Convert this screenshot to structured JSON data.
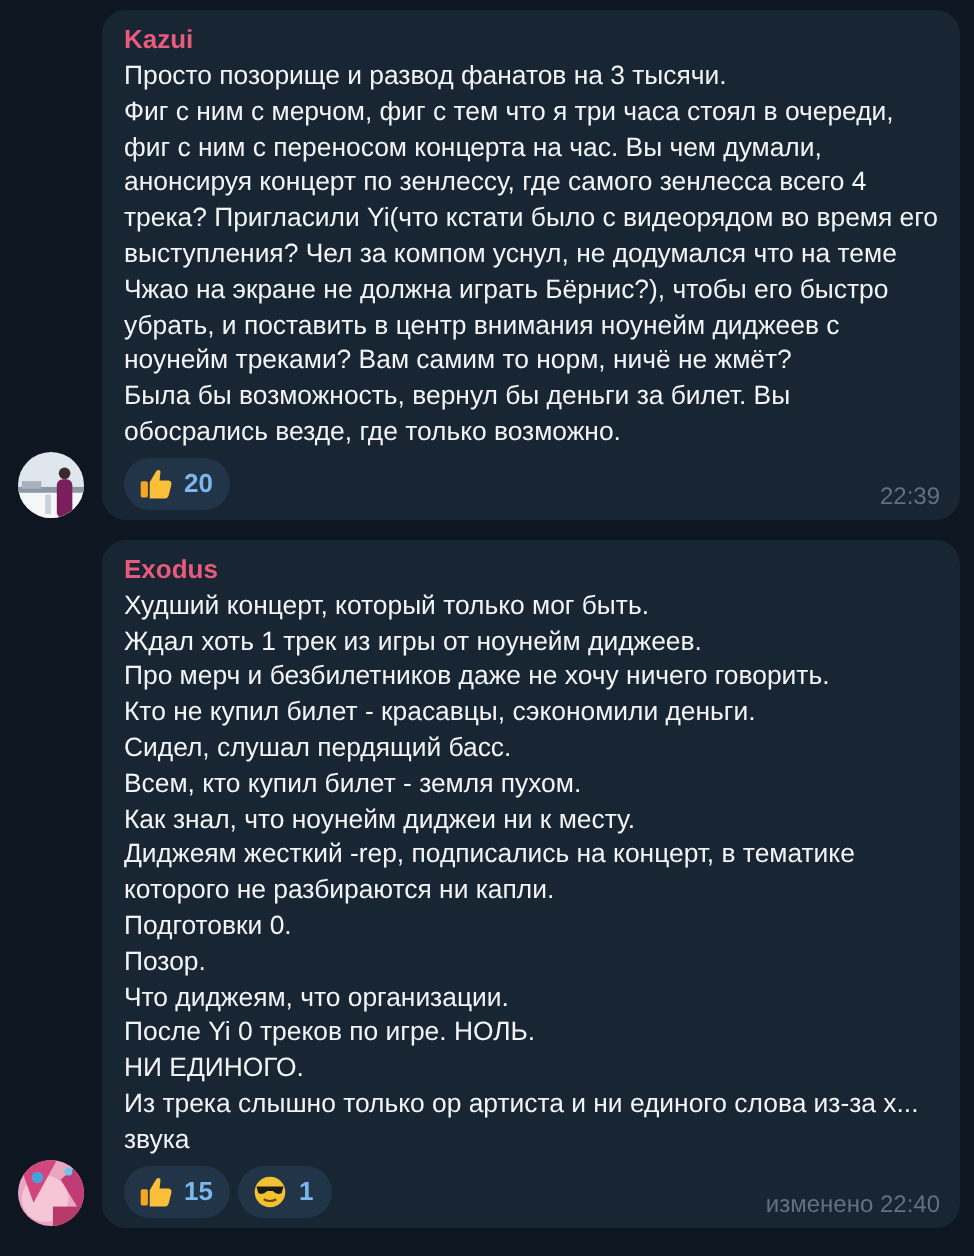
{
  "messages": [
    {
      "author": "Kazui",
      "avatar": {
        "kind": "picture"
      },
      "paragraphs": [
        "Просто позорище и развод фанатов на 3 тысячи.",
        "Фиг с ним с мерчом, фиг с тем что я три часа стоял в очереди, фиг с ним с переносом концерта на час. Вы чем думали, анонсируя концерт по зенлессу, где самого зенлесса всего 4 трека? Пригласили Yi(что кстати было с видеорядом во время его выступления? Чел за компом уснул, не додумался что на теме Чжао на экране не должна играть Бёрнис?), чтобы его быстро убрать, и поставить в центр внимания ноунейм диджеев с ноунейм треками? Вам самим то норм, ничё не жмёт?",
        "Была бы возможность, вернул бы деньги за билет. Вы обосрались везде, где только возможно."
      ],
      "reactions": [
        {
          "kind": "thumbs_up",
          "count": "20"
        }
      ],
      "time": "22:39"
    },
    {
      "author": "Exodus",
      "avatar": {
        "kind": "picture"
      },
      "paragraphs": [
        "Худший концерт, который только мог быть.",
        "Ждал хоть 1 трек из игры от ноунейм диджеев.",
        "Про мерч и безбилетников даже не хочу ничего говорить.",
        "Кто не купил билет - красавцы, сэкономили деньги.",
        "Сидел, слушал пердящий басс.",
        "Всем, кто купил билет - земля пухом.",
        "Как знал, что ноунейм диджеи ни к месту.",
        "Диджеям жесткий -rep, подписались на концерт, в тематике которого не разбираются ни капли.",
        "Подготовки 0.",
        "Позор.",
        "Что диджеям, что организации.",
        "После Yi 0 треков по игре. НОЛЬ.",
        "НИ ЕДИНОГО.",
        "Из трека слышно только ор артиста и ни единого слова из-за х... звука"
      ],
      "reactions": [
        {
          "kind": "thumbs_up",
          "count": "15"
        },
        {
          "kind": "sunglasses",
          "count": "1"
        }
      ],
      "edited_label": "изменено",
      "time": "22:40"
    }
  ]
}
